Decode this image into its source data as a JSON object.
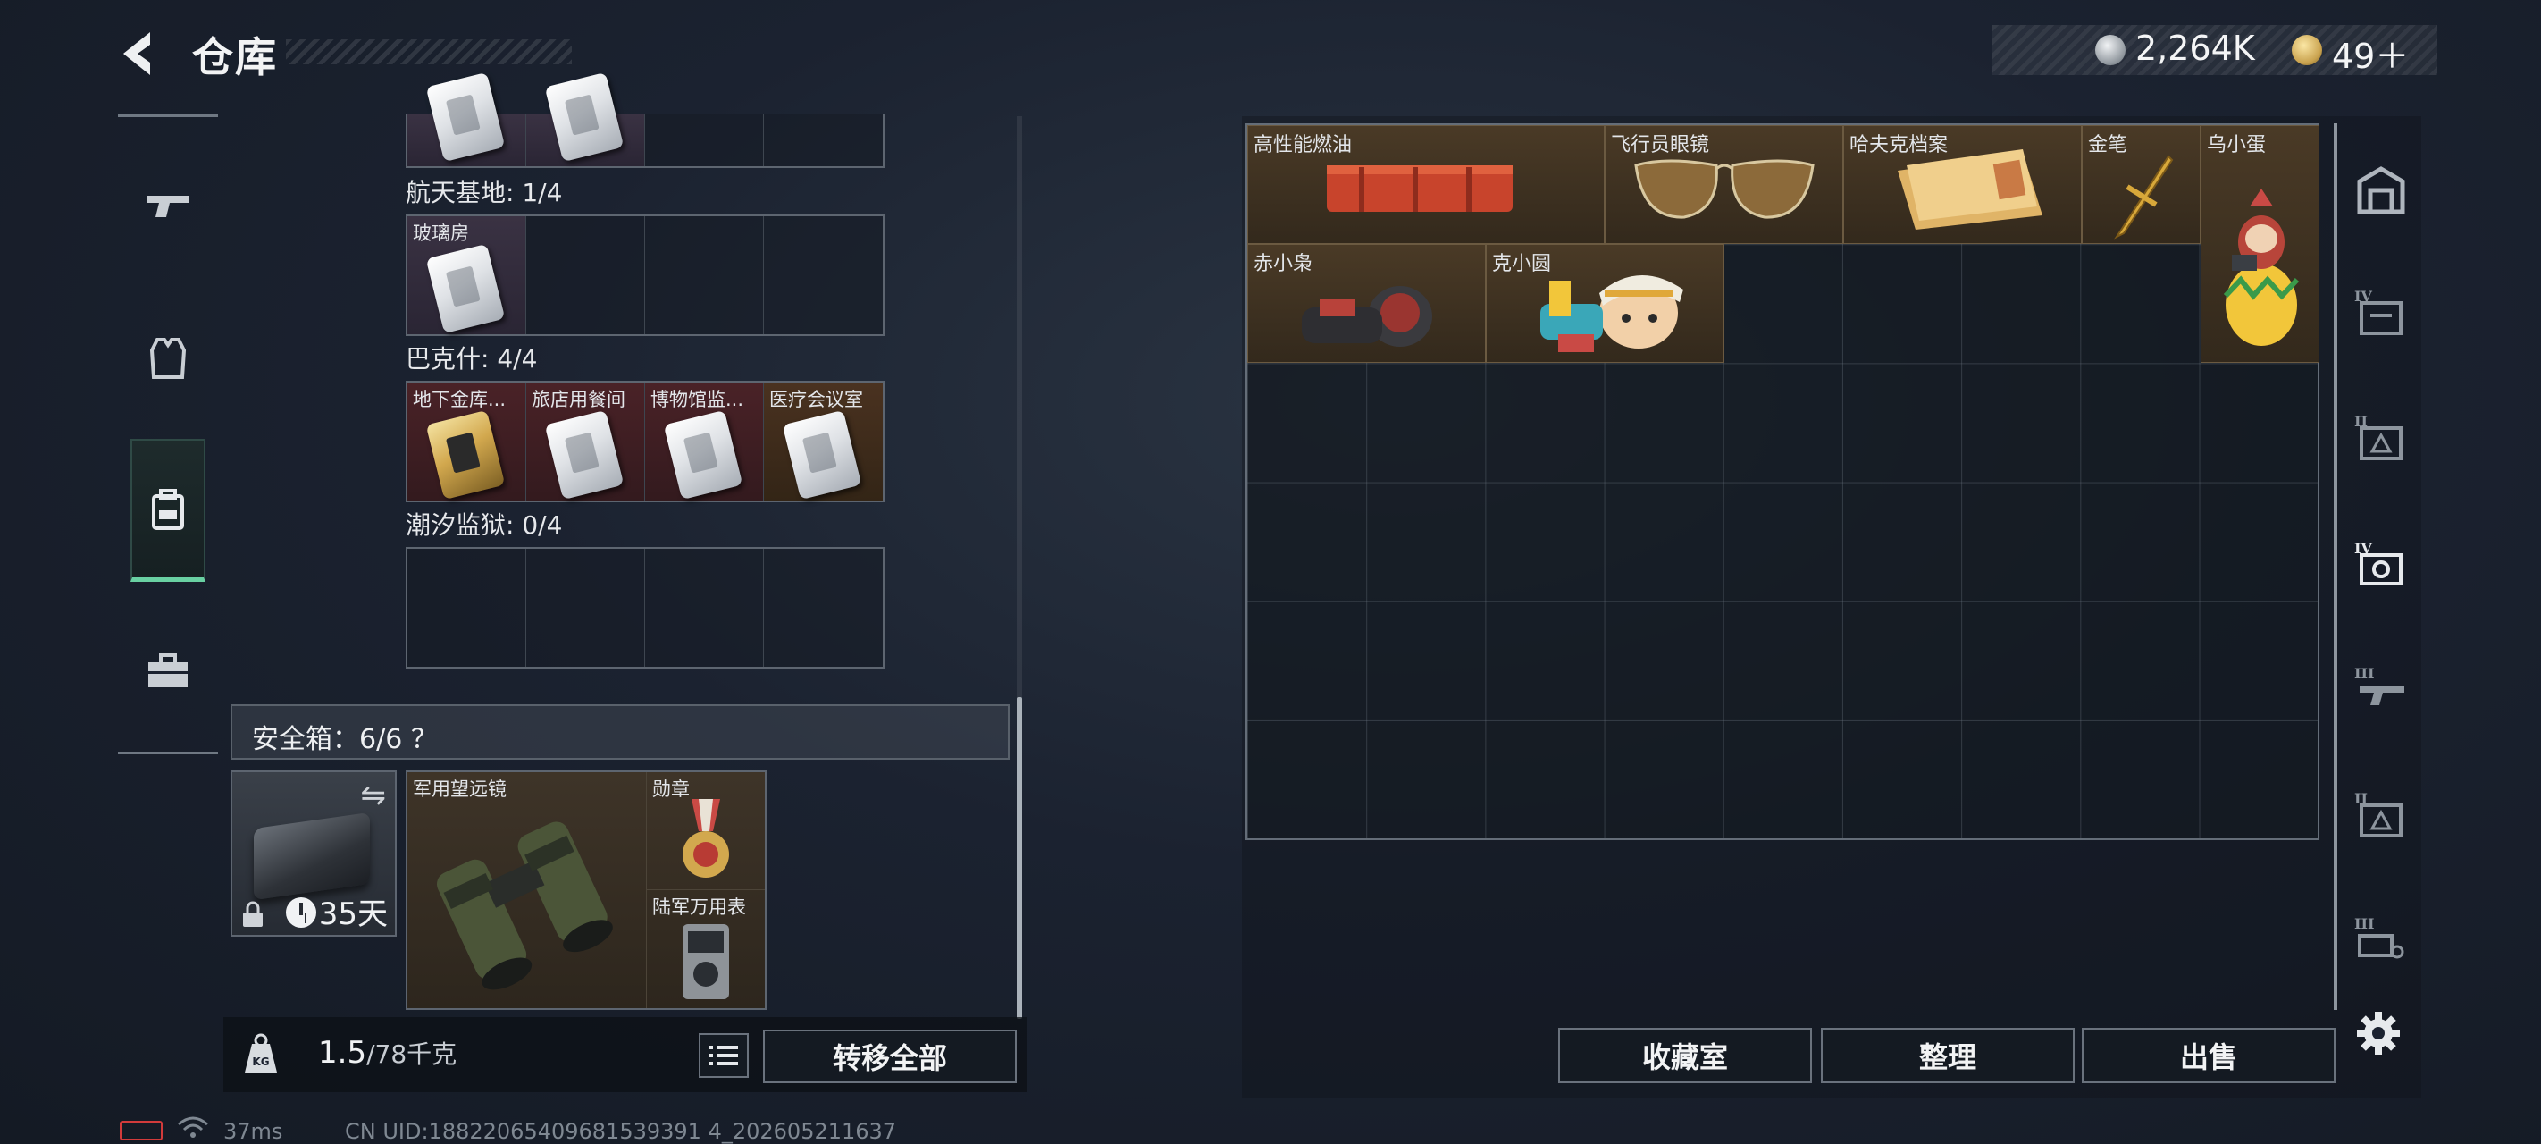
{
  "header": {
    "title": "仓库"
  },
  "currency": {
    "silver": "2,264K",
    "gold": "49＋"
  },
  "sidebar": {
    "tabs": [
      {
        "name": "weapons",
        "icon": "gun-icon"
      },
      {
        "name": "armor",
        "icon": "vest-icon"
      },
      {
        "name": "backpack",
        "icon": "backpack-icon",
        "active": true
      },
      {
        "name": "supplies",
        "icon": "toolbox-icon"
      }
    ]
  },
  "keycards": {
    "groups": [
      {
        "label": "航天基地: 1/4",
        "items": [
          "玻璃房",
          "",
          "",
          ""
        ]
      },
      {
        "label": "巴克什: 4/4",
        "items": [
          "地下金库...",
          "旅店用餐间",
          "博物馆监...",
          "医疗会议室"
        ]
      },
      {
        "label": "潮汐监狱: 0/4",
        "items": [
          "",
          "",
          "",
          ""
        ]
      }
    ]
  },
  "safe_box": {
    "header": "安全箱：6/6 ？",
    "days": "35天",
    "items": {
      "binoculars": "军用望远镜",
      "medal": "勋章",
      "watch": "陆军万用表"
    }
  },
  "weight": {
    "current": "1.5",
    "capacity": "/78千克"
  },
  "buttons": {
    "transfer_all": "转移全部",
    "collection": "收藏室",
    "organize": "整理",
    "sell": "出售"
  },
  "storage_items": {
    "fuel": "高性能燃油",
    "aviator_glasses": "飞行员眼镜",
    "hafuke_files": "哈夫克档案",
    "gold_pen": "金笔",
    "egg_figure": "乌小蛋",
    "red_owl": "赤小枭",
    "ke_xiaoyuan": "克小圆"
  },
  "filters": [
    "locker-icon",
    "tier4-case-icon",
    "tier2-case-icon",
    "tier4-camera-icon",
    "tier3-weapon-icon",
    "tier2-case-icon",
    "tier3-key-icon"
  ],
  "status": {
    "ping": "37ms",
    "uid": "CN UID:18822065409681539391 4_202605211637"
  },
  "colors": {
    "accent": "#69d0a2",
    "gold_item_bg": "#4a3a26",
    "purple_item_bg": "#3a3243",
    "red_item_bg": "#4a2227"
  }
}
